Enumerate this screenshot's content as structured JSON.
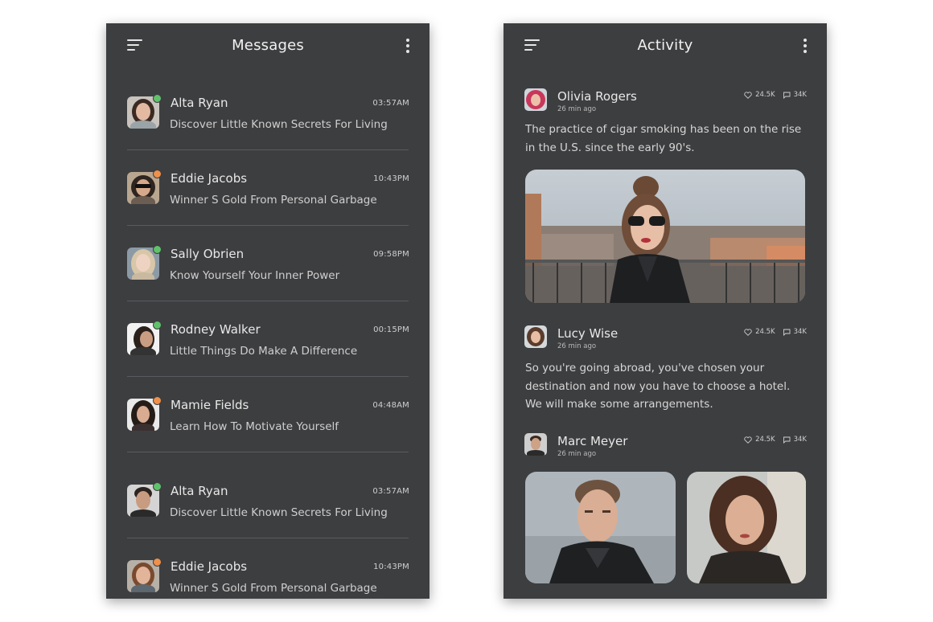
{
  "messages_screen": {
    "title": "Messages",
    "items": [
      {
        "name": "Alta Ryan",
        "time": "03:57AM",
        "preview": "Discover Little Known Secrets For Living",
        "status": "online"
      },
      {
        "name": "Eddie Jacobs",
        "time": "10:43PM",
        "preview": "Winner S Gold From Personal Garbage",
        "status": "away"
      },
      {
        "name": "Sally Obrien",
        "time": "09:58PM",
        "preview": "Know Yourself Your Inner Power",
        "status": "online"
      },
      {
        "name": "Rodney Walker",
        "time": "00:15PM",
        "preview": "Little Things Do Make A Difference",
        "status": "online"
      },
      {
        "name": "Mamie Fields",
        "time": "04:48AM",
        "preview": "Learn How To Motivate Yourself",
        "status": "away"
      },
      {
        "name": "Alta Ryan",
        "time": "03:57AM",
        "preview": "Discover Little Known Secrets For Living",
        "status": "online"
      },
      {
        "name": "Eddie Jacobs",
        "time": "10:43PM",
        "preview": "Winner S Gold From Personal Garbage",
        "status": "away"
      }
    ]
  },
  "activity_screen": {
    "title": "Activity",
    "posts": [
      {
        "name": "Olivia Rogers",
        "ago": "26 min ago",
        "likes": "24.5K",
        "comments": "34K",
        "text": "The practice of cigar smoking has been on the rise in the U.S. since the early 90's."
      },
      {
        "name": "Lucy Wise",
        "ago": "26 min ago",
        "likes": "24.5K",
        "comments": "34K",
        "text": "So you're going abroad, you've chosen your destination and now you have to choose a hotel. We will make some arrangements."
      },
      {
        "name": "Marc Meyer",
        "ago": "26 min ago",
        "likes": "24.5K",
        "comments": "34K",
        "text": ""
      }
    ]
  },
  "colors": {
    "panel": "#3d3e40",
    "online": "#5fc26a",
    "away": "#f0904a",
    "divider": "#5a5b5e"
  }
}
